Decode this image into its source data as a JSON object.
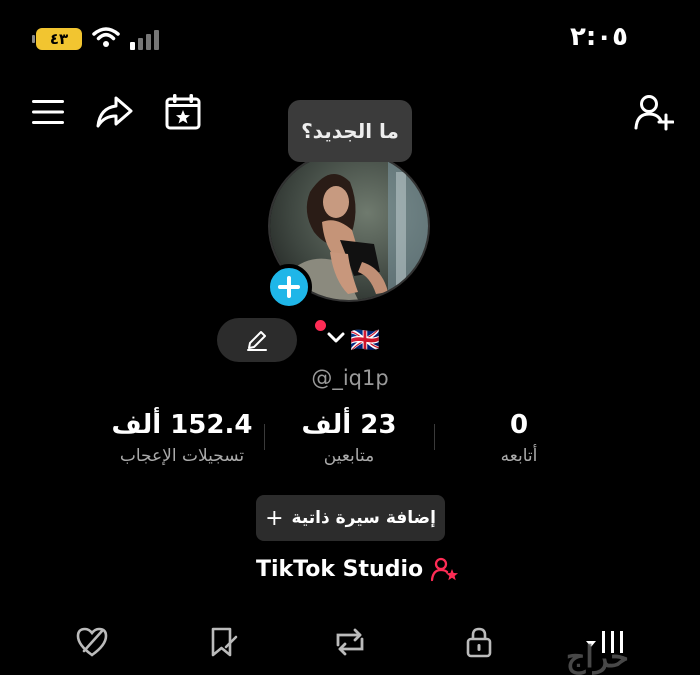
{
  "status_bar": {
    "time": "٢:٠٥",
    "battery": "٤٣"
  },
  "tooltip": "ما الجديد؟",
  "profile": {
    "username": "@_iq1p",
    "flag": "🇬🇧"
  },
  "stats": [
    {
      "value": "152.4 ألف",
      "label": "تسجيلات الإعجاب"
    },
    {
      "value": "23 ألف",
      "label": "متابعين"
    },
    {
      "value": "0",
      "label": "أتابعه"
    }
  ],
  "bio_button": {
    "icon": "+",
    "label": "إضافة سيرة ذاتية"
  },
  "studio": {
    "label": "TikTok Studio"
  },
  "watermark": "حراج",
  "colors": {
    "accent_blue": "#1fb6e8",
    "accent_red": "#fe2c55",
    "battery": "#f2c530"
  },
  "icons": [
    "menu-icon",
    "share-icon",
    "calendar-star-icon",
    "add-friend-icon",
    "edit-icon",
    "chevron-down-icon",
    "liked-videos-icon",
    "saved-icon",
    "reposts-icon",
    "private-lock-icon",
    "videos-grid-icon"
  ]
}
